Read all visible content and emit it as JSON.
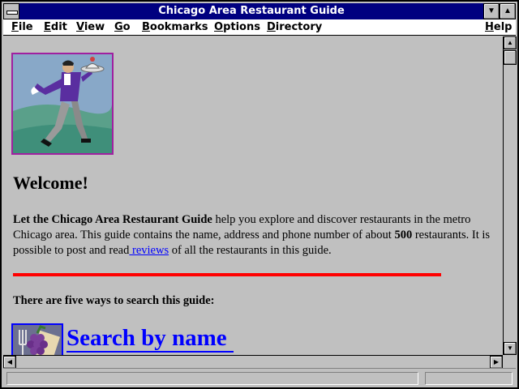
{
  "window": {
    "title": "Chicago Area Restaurant Guide"
  },
  "menu": {
    "file": {
      "mnemonic": "F",
      "rest": "ile"
    },
    "edit": {
      "mnemonic": "E",
      "rest": "dit"
    },
    "view": {
      "mnemonic": "V",
      "rest": "iew"
    },
    "go": {
      "mnemonic": "G",
      "rest": "o"
    },
    "bookmarks": {
      "mnemonic": "B",
      "rest": "ookmarks"
    },
    "options": {
      "mnemonic": "O",
      "rest": "ptions"
    },
    "directory": {
      "mnemonic": "D",
      "rest": "irectory"
    },
    "help": {
      "mnemonic": "H",
      "rest": "elp"
    }
  },
  "page": {
    "welcome": "Welcome!",
    "intro_bold": "Let the Chicago Area Restaurant Guide",
    "intro_1": " help you explore and discover restaurants in the metro Chicago area. This guide contains the name, address and phone number of about ",
    "count": "500",
    "intro_2": " restaurants. It is possible to post and read",
    "reviews_link": " reviews",
    "intro_3": " of all the restaurants in this guide.",
    "five_ways": "There are five ways to search this guide:",
    "search_by_name": "Search by name"
  },
  "colors": {
    "title_bar": "#000080",
    "link": "#0000ff",
    "rule": "#ff0000",
    "background": "#c0c0c0"
  },
  "icons": {
    "logo": "waiter-serving-dish-icon",
    "search": "restaurant-fork-grapes-icon"
  }
}
